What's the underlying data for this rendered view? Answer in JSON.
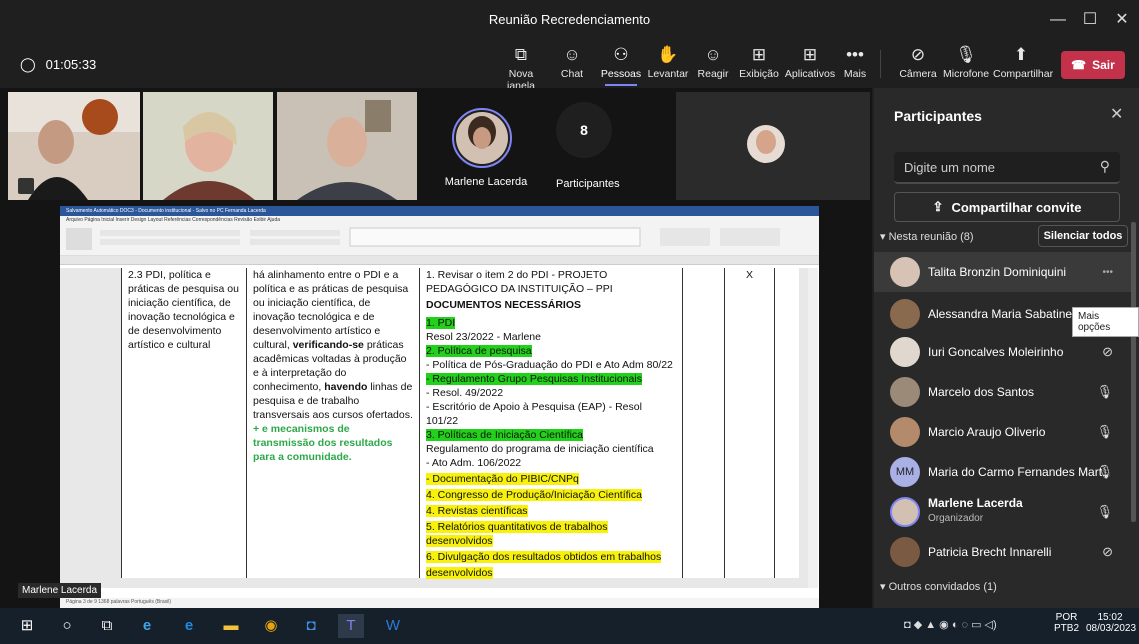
{
  "window": {
    "title": "Reunião Recredenciamento"
  },
  "toolbar": {
    "timer": "01:05:33",
    "items": [
      {
        "label": "Nova janela",
        "icon": "popout-icon"
      },
      {
        "label": "Chat",
        "icon": "chat-icon"
      },
      {
        "label": "Pessoas",
        "icon": "people-icon"
      },
      {
        "label": "Levantar",
        "icon": "raise-hand-icon"
      },
      {
        "label": "Reagir",
        "icon": "smile-icon"
      },
      {
        "label": "Exibição",
        "icon": "layout-icon"
      },
      {
        "label": "Aplicativos",
        "icon": "apps-icon"
      },
      {
        "label": "Mais",
        "icon": "more-icon"
      },
      {
        "label": "Câmera",
        "icon": "camera-off-icon"
      },
      {
        "label": "Microfone",
        "icon": "mic-icon"
      },
      {
        "label": "Compartilhar",
        "icon": "share-icon"
      }
    ],
    "leave_label": "Sair"
  },
  "stage": {
    "spotlight_name": "Marlene Lacerda",
    "participants_count": "8",
    "participants_label": "Participantes",
    "bottom_name": "Marlene Lacerda"
  },
  "word": {
    "title_bar": "Salvamento Automático   DOC3 - Documento institucional - Salvo no PC        Fernanda Lacerda",
    "tabs": "Arquivo   Página Inicial   Inserir   Design   Layout   Referências   Correspondências   Revisão   Exibir   Ajuda",
    "status": "Página 3 de 9    1368 palavras    Português (Brasil)",
    "col1": "2.3 PDI, política e práticas de pesquisa ou iniciação científica, de inovação tecnológica e de desenvolvimento artístico e cultural",
    "col2_a": "há alinhamento entre o PDI e a política e as práticas de pesquisa ou iniciação científica, de inovação tecnológica e de desenvolvimento artístico e cultural,",
    "col2_b": "verificando-se",
    "col2_c": "práticas acadêmicas voltadas à produção e à interpretação do conhecimento,",
    "col2_d": "havendo",
    "col2_e": "linhas de pesquisa e de trabalho transversais aos cursos ofertados.",
    "col2_green": "+ e mecanismos de transmissão dos resultados para a comunidade.",
    "col3": {
      "line0": "1. Revisar o item 2 do PDI - PROJETO PEDAGÓGICO DA INSTITUIÇÃO – PPI",
      "heading": "DOCUMENTOS NECESSÁRIOS",
      "i1": "1. PDI",
      "i1a": "Resol  23/2022 - Marlene",
      "i2": "2. Política de pesquisa",
      "i2a": "- Política de Pós-Graduação do PDI e Ato Adm  80/22",
      "i2b": "- Regulamento Grupo Pesquisas Institucionais",
      "i2c": "- Resol. 49/2022",
      "i2d": "- Escritório de Apoio à Pesquisa (EAP) - Resol 101/22",
      "i3": "3. Políticas de Iniciação Científica",
      "i3a": "Regulamento do programa de iniciação científica",
      "i3b": "- Ato Adm. 106/2022",
      "i3c": "- Documentação do PIBIC/CNPq",
      "i4": "4. Congresso de Produção/Iniciação Científica",
      "i5": "4. Revistas científicas",
      "i6": "5. Relatórios quantitativos de trabalhos desenvolvidos",
      "i7a": "6. Divulgação dos resultados obtidos em trabalhos",
      "i7b": "desenvolvidos"
    },
    "col4_mark": "X"
  },
  "panel": {
    "title": "Participantes",
    "search_placeholder": "Digite um nome",
    "invite_label": "Compartilhar convite",
    "in_meeting": "Nesta reunião (8)",
    "mute_all": "Silenciar todos",
    "tooltip": "Mais opções",
    "others": "Outros convidados (1)",
    "participants": [
      {
        "name": "Talita Bronzin Dominiquini",
        "sub": "",
        "status": "•••",
        "initials": ""
      },
      {
        "name": "Alessandra Maria Sabatine Zamb...",
        "sub": "",
        "status": "mic-off",
        "initials": ""
      },
      {
        "name": "Iuri Goncalves Moleirinho",
        "sub": "",
        "status": "mic-off",
        "initials": ""
      },
      {
        "name": "Marcelo dos Santos",
        "sub": "",
        "status": "mic-on",
        "initials": ""
      },
      {
        "name": "Marcio Araujo Oliverio",
        "sub": "",
        "status": "mic-on",
        "initials": ""
      },
      {
        "name": "Maria do Carmo Fernandes Mart...",
        "sub": "",
        "status": "mic-on",
        "initials": "MM"
      },
      {
        "name": "Marlene Lacerda",
        "sub": "Organizador",
        "status": "mic-on",
        "initials": ""
      },
      {
        "name": "Patricia Brecht Innarelli",
        "sub": "",
        "status": "mic-off",
        "initials": ""
      }
    ]
  },
  "taskbar": {
    "lang": "POR",
    "lang2": "PTB2",
    "time": "15:02",
    "date": "08/03/2023"
  }
}
